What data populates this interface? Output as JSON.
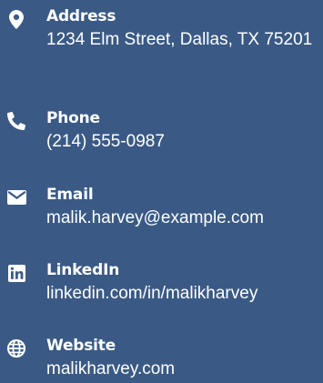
{
  "contact": {
    "items": [
      {
        "icon": "map-marker-icon",
        "label": "Address",
        "value": "1234 Elm Street, Dallas, TX 75201"
      },
      {
        "icon": "phone-icon",
        "label": "Phone",
        "value": "(214) 555-0987"
      },
      {
        "icon": "envelope-icon",
        "label": "Email",
        "value": "malik.harvey@example.com"
      },
      {
        "icon": "linkedin-icon",
        "label": "LinkedIn",
        "value": "linkedin.com/in/malikharvey"
      },
      {
        "icon": "globe-icon",
        "label": "Website",
        "value": "malikharvey.com"
      }
    ]
  },
  "colors": {
    "background": "#3a5a85",
    "text": "#ffffff"
  }
}
